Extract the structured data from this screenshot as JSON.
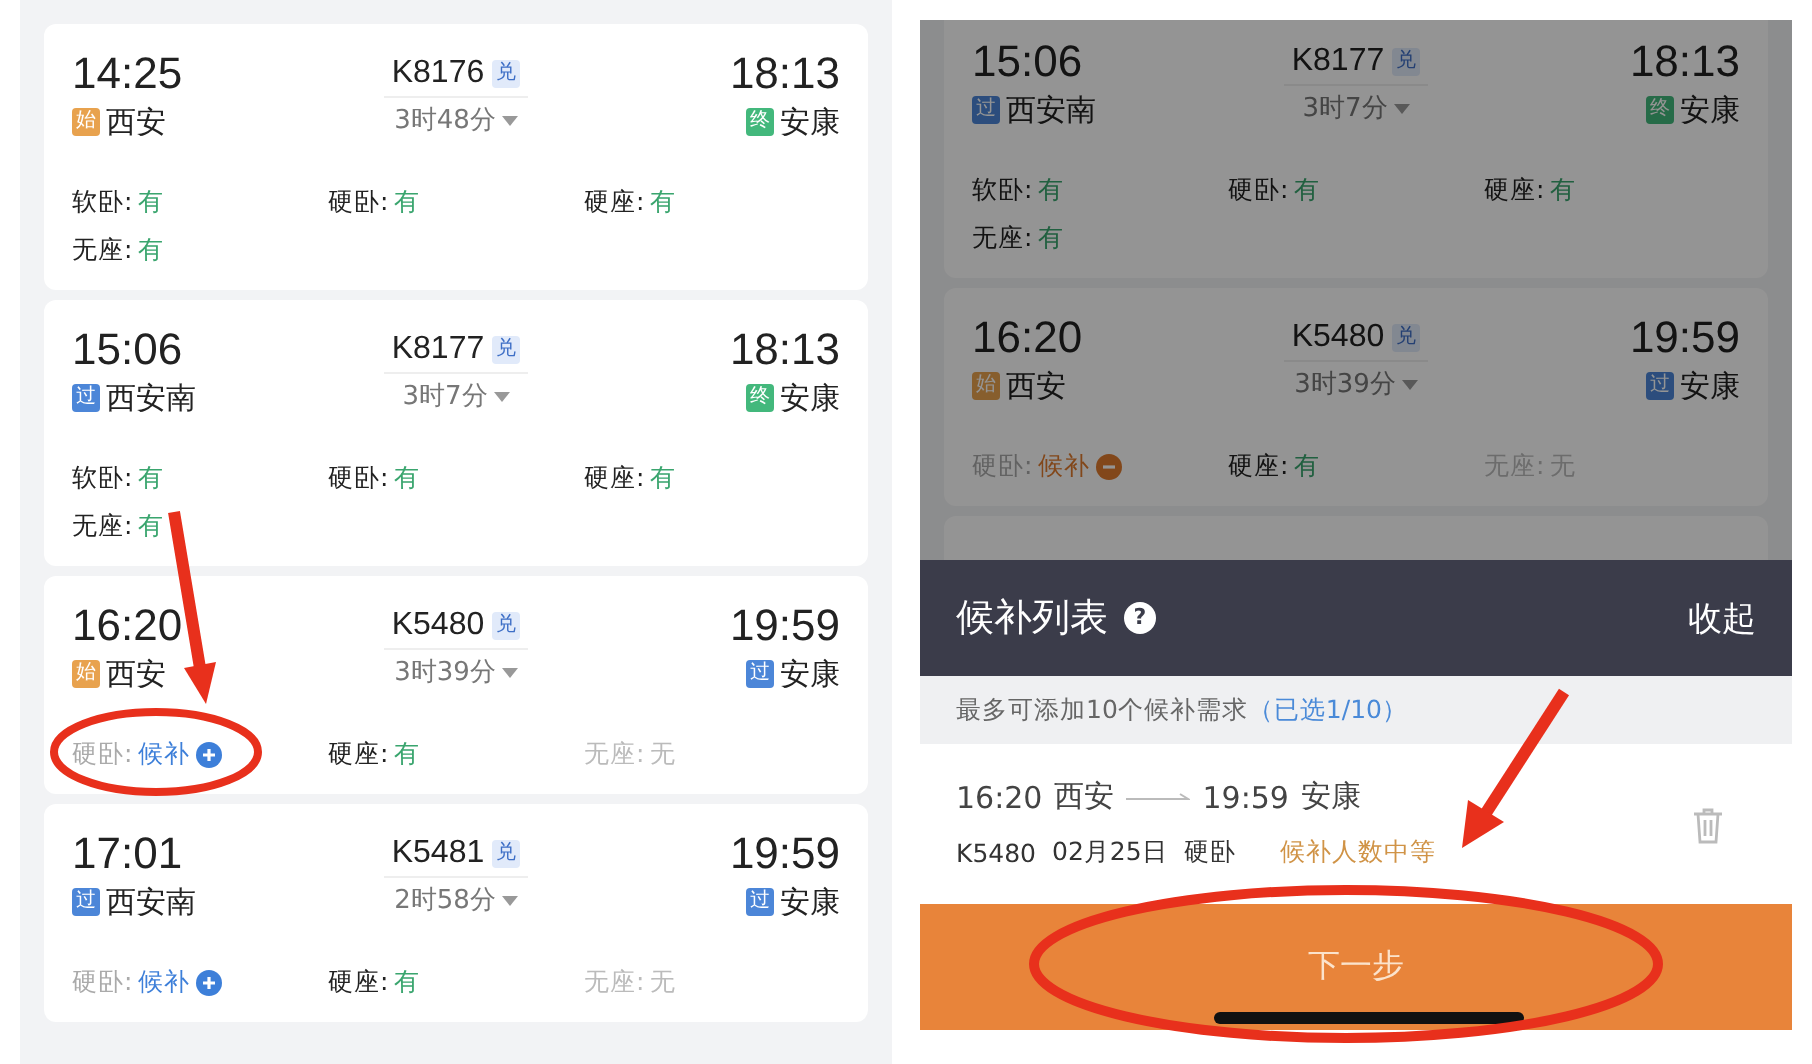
{
  "train_list": {
    "trains": [
      {
        "depart_time": "14:25",
        "depart_badge": {
          "kind": "start",
          "label": "始"
        },
        "depart_station": "西安",
        "train_no": "K8176",
        "tag": "兑",
        "duration": "3时48分",
        "arrive_time": "18:13",
        "arrive_badge": {
          "kind": "end",
          "label": "终"
        },
        "arrive_station": "安康",
        "seats": [
          {
            "name": "软卧:",
            "status": "有",
            "kind": "available"
          },
          {
            "name": "硬卧:",
            "status": "有",
            "kind": "available"
          },
          {
            "name": "硬座:",
            "status": "有",
            "kind": "available"
          },
          {
            "name": "无座:",
            "status": "有",
            "kind": "available"
          }
        ]
      },
      {
        "depart_time": "15:06",
        "depart_badge": {
          "kind": "pass",
          "label": "过"
        },
        "depart_station": "西安南",
        "train_no": "K8177",
        "tag": "兑",
        "duration": "3时7分",
        "arrive_time": "18:13",
        "arrive_badge": {
          "kind": "end",
          "label": "终"
        },
        "arrive_station": "安康",
        "seats": [
          {
            "name": "软卧:",
            "status": "有",
            "kind": "available"
          },
          {
            "name": "硬卧:",
            "status": "有",
            "kind": "available"
          },
          {
            "name": "硬座:",
            "status": "有",
            "kind": "available"
          },
          {
            "name": "无座:",
            "status": "有",
            "kind": "available"
          }
        ]
      },
      {
        "depart_time": "16:20",
        "depart_badge": {
          "kind": "start",
          "label": "始"
        },
        "depart_station": "西安",
        "train_no": "K5480",
        "tag": "兑",
        "duration": "3时39分",
        "arrive_time": "19:59",
        "arrive_badge": {
          "kind": "pass",
          "label": "过"
        },
        "arrive_station": "安康",
        "seats": [
          {
            "name": "硬卧:",
            "status": "候补",
            "kind": "waitlist",
            "selected": false
          },
          {
            "name": "硬座:",
            "status": "有",
            "kind": "available"
          },
          {
            "name": "无座:",
            "status": "无",
            "kind": "none"
          }
        ]
      },
      {
        "depart_time": "17:01",
        "depart_badge": {
          "kind": "pass",
          "label": "过"
        },
        "depart_station": "西安南",
        "train_no": "K5481",
        "tag": "兑",
        "duration": "2时58分",
        "arrive_time": "19:59",
        "arrive_badge": {
          "kind": "pass",
          "label": "过"
        },
        "arrive_station": "安康",
        "seats": [
          {
            "name": "硬卧:",
            "status": "候补",
            "kind": "waitlist",
            "selected": false
          },
          {
            "name": "硬座:",
            "status": "有",
            "kind": "available"
          },
          {
            "name": "无座:",
            "status": "无",
            "kind": "none"
          }
        ]
      }
    ]
  },
  "background_list": {
    "trains": [
      {
        "depart_time": "15:06",
        "depart_badge": {
          "kind": "pass",
          "label": "过"
        },
        "depart_station": "西安南",
        "train_no": "K8177",
        "tag": "兑",
        "duration": "3时7分",
        "arrive_time": "18:13",
        "arrive_badge": {
          "kind": "end",
          "label": "终"
        },
        "arrive_station": "安康",
        "seats": [
          {
            "name": "软卧:",
            "status": "有",
            "kind": "available"
          },
          {
            "name": "硬卧:",
            "status": "有",
            "kind": "available"
          },
          {
            "name": "硬座:",
            "status": "有",
            "kind": "available"
          },
          {
            "name": "无座:",
            "status": "有",
            "kind": "available"
          }
        ]
      },
      {
        "depart_time": "16:20",
        "depart_badge": {
          "kind": "start",
          "label": "始"
        },
        "depart_station": "西安",
        "train_no": "K5480",
        "tag": "兑",
        "duration": "3时39分",
        "arrive_time": "19:59",
        "arrive_badge": {
          "kind": "pass",
          "label": "过"
        },
        "arrive_station": "安康",
        "seats": [
          {
            "name": "硬卧:",
            "status": "候补",
            "kind": "waitlist",
            "selected": true
          },
          {
            "name": "硬座:",
            "status": "有",
            "kind": "available"
          },
          {
            "name": "无座:",
            "status": "无",
            "kind": "none"
          }
        ]
      }
    ]
  },
  "waitlist_sheet": {
    "title": "候补列表",
    "help_icon": "?",
    "collapse": "收起",
    "notice": "最多可添加10个候补需求",
    "selected_count": "（已选1/10）",
    "items": [
      {
        "depart_time": "16:20",
        "depart_station": "西安",
        "arrive_time": "19:59",
        "arrive_station": "安康",
        "train_no": "K5480",
        "date": "02月25日",
        "seat": "硬卧",
        "status": "候补人数中等"
      }
    ],
    "next_button": "下一步"
  }
}
